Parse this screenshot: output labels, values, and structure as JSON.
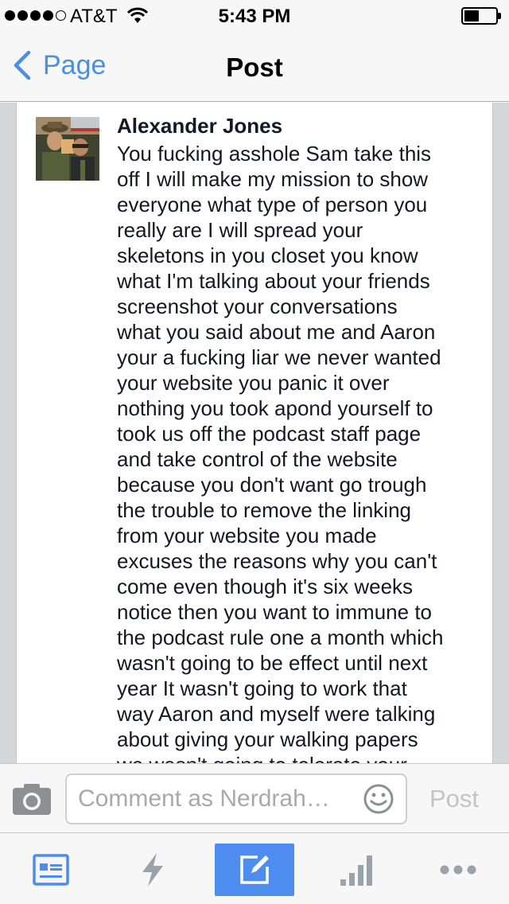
{
  "status_bar": {
    "carrier": "AT&T",
    "time": "5:43 PM",
    "signal_bars": 4,
    "battery_level": 0.4
  },
  "nav": {
    "back_label": "Page",
    "title": "Post",
    "accent_color": "#4a90e2"
  },
  "post": {
    "author": "Alexander Jones",
    "body": "You fucking asshole Sam take this\noff I will make my mission to show\neveryone what type of person you\nreally are I will spread your\nskeletons in you closet you know\nwhat I'm talking about  your friends\nscreenshot your conversations\nwhat you said about me and Aaron\nyour a fucking liar we never wanted\nyour website you panic it over\nnothing you took apond yourself to\ntook us off the podcast staff page\nand take control of the website\nbecause you don't want go trough\nthe trouble to remove the linking\nfrom your website you made\nexcuses the reasons why you can't\ncome even though it's six weeks\nnotice then you want to immune to\nthe podcast rule one a month which\nwasn't going to be effect until next\nyear It wasn't going to work that\nway Aaron and myself were talking\nabout giving your walking papers\nwe wasn't going to tolerate your"
  },
  "comment_bar": {
    "placeholder": "Comment as Nerdrah…",
    "value": "",
    "post_label": "Post",
    "icons": [
      "camera-icon",
      "smiley-icon"
    ]
  },
  "tab_bar": {
    "tabs": [
      {
        "name": "news-feed",
        "icon": "news-feed-icon",
        "active": false
      },
      {
        "name": "activity",
        "icon": "lightning-icon",
        "active": false
      },
      {
        "name": "compose",
        "icon": "compose-icon",
        "active": true
      },
      {
        "name": "insights",
        "icon": "bar-chart-icon",
        "active": false
      },
      {
        "name": "more",
        "icon": "more-icon",
        "active": false
      }
    ],
    "active_color": "#4f8cf0",
    "icon_color": "#9aa2ab"
  }
}
